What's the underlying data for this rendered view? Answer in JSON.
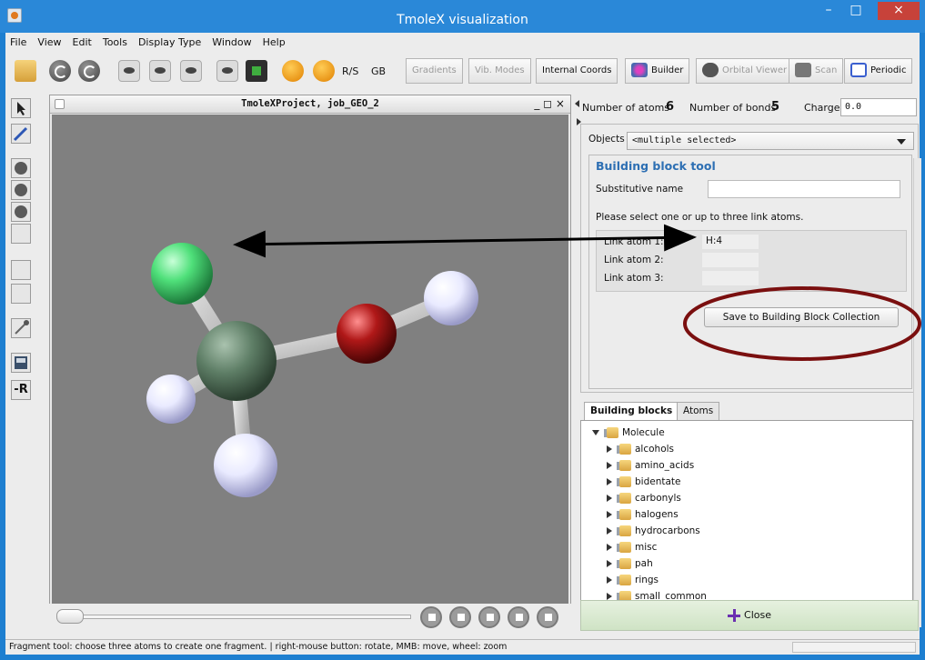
{
  "window": {
    "title": "TmoleX visualization",
    "controls": {
      "minimize": "–",
      "maximize": "□",
      "close": "×"
    }
  },
  "menu": [
    "File",
    "View",
    "Edit",
    "Tools",
    "Display Type",
    "Window",
    "Help"
  ],
  "toolbar": {
    "rs_label": "R/S",
    "gb_label": "GB",
    "tabs": [
      {
        "label": "Gradients",
        "enabled": false
      },
      {
        "label": "Vib. Modes",
        "enabled": false
      },
      {
        "label": "Internal Coords",
        "enabled": true
      },
      {
        "label": "Builder",
        "enabled": true,
        "icon": "builder-icon"
      },
      {
        "label": "Orbital Viewer",
        "enabled": false,
        "icon": "orbital-viewer-icon"
      },
      {
        "label": "Scan",
        "enabled": false,
        "icon": "scan-icon"
      },
      {
        "label": "Periodic",
        "enabled": true,
        "icon": "periodic-icon"
      }
    ]
  },
  "left_tools": [
    "select-arrow-icon",
    "draw-pen-icon",
    "move-icon",
    "rotate-icon",
    "zoom-icon",
    "fit-icon",
    "rotate-bond-icon",
    "torsion-icon",
    "bond-tool-icon",
    "fragment-save-icon",
    "remove-r-icon"
  ],
  "left_tools_text": {
    "remove_r": "-R"
  },
  "viewer": {
    "title": "TmoleXProject, job_GEO_2",
    "controls": "_ ◻ ×",
    "atoms": [
      {
        "element": "Cl",
        "color": "#4fe07a"
      },
      {
        "element": "C",
        "color": "#5e7e66"
      },
      {
        "element": "O",
        "color": "#b01818"
      },
      {
        "element": "H",
        "color": "#e9eaff"
      },
      {
        "element": "H",
        "color": "#e9eaff"
      },
      {
        "element": "H",
        "color": "#e9eaff"
      }
    ],
    "background": "#808080"
  },
  "info": {
    "atoms_label": "Number of atoms",
    "atoms_value": "6",
    "bonds_label": "Number of bonds",
    "bonds_value": "5",
    "charge_label": "Charge",
    "charge_value": "0.0"
  },
  "objects": {
    "label": "Objects",
    "selected": "<multiple selected>"
  },
  "builder": {
    "title": "Building block tool",
    "substitutive_label": "Substitutive name",
    "substitutive_value": "",
    "hint": "Please select one or up to three link atoms.",
    "link_atoms": [
      {
        "label": "Link atom 1:",
        "value": "H:4"
      },
      {
        "label": "Link atom 2:",
        "value": ""
      },
      {
        "label": "Link atom 3:",
        "value": ""
      }
    ],
    "save_button": "Save to Building Block Collection"
  },
  "tree": {
    "tabs": [
      {
        "label": "Building blocks",
        "active": true
      },
      {
        "label": "Atoms",
        "active": false
      }
    ],
    "root": "Molecule",
    "items": [
      "alcohols",
      "amino_acids",
      "bidentate",
      "carbonyls",
      "halogens",
      "hydrocarbons",
      "misc",
      "pah",
      "rings",
      "small_common"
    ]
  },
  "close_button": "Close",
  "status": "Fragment tool: choose three atoms to create one fragment. | right-mouse button: rotate, MMB: move, wheel: zoom",
  "annotation_colors": {
    "highlight_ring": "#7a0f0f",
    "arrow": "#000000"
  }
}
